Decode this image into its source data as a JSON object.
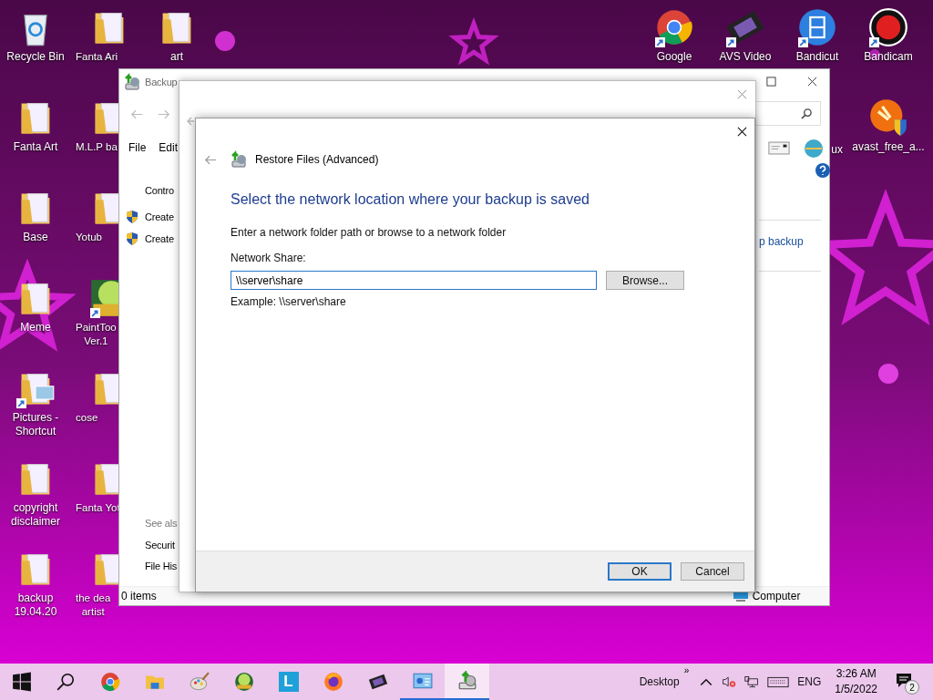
{
  "desktop": {
    "left_columns": [
      [
        {
          "label": "Recycle Bin",
          "kind": "recycle-bin",
          "shortcut": false
        },
        {
          "label": "Fanta Art",
          "kind": "folder",
          "shortcut": false
        },
        {
          "label": "Base",
          "kind": "folder",
          "shortcut": false
        },
        {
          "label": "Meme",
          "kind": "folder",
          "shortcut": false
        },
        {
          "label": "Pictures -\nShortcut",
          "kind": "pictures",
          "shortcut": true
        },
        {
          "label": "copyright\ndisclaimer",
          "kind": "folder",
          "shortcut": false
        },
        {
          "label": "backup\n19.04.20",
          "kind": "folder",
          "shortcut": false
        }
      ],
      [
        {
          "label": "Fanta Ari",
          "kind": "folder",
          "shortcut": false
        },
        {
          "label": "M.L.P ba",
          "kind": "folder",
          "shortcut": false
        },
        {
          "label": "Yotub",
          "kind": "folder",
          "shortcut": false
        },
        {
          "label": "PaintToo\nVer.1",
          "kind": "painttool",
          "shortcut": true
        },
        {
          "label": "cose",
          "kind": "folder",
          "shortcut": false
        },
        {
          "label": "Fanta Yot",
          "kind": "folder",
          "shortcut": false
        },
        {
          "label": "the dea\nartist",
          "kind": "folder",
          "shortcut": false
        }
      ],
      [
        {
          "label": "art",
          "kind": "folder",
          "shortcut": false
        }
      ]
    ],
    "right_rows": [
      [
        {
          "label": "Google",
          "kind": "chrome",
          "shortcut": true
        },
        {
          "label": "AVS Video",
          "kind": "film",
          "shortcut": true
        },
        {
          "label": "Bandicut",
          "kind": "bandicut",
          "shortcut": true
        },
        {
          "label": "Bandicam",
          "kind": "bandicam",
          "shortcut": true
        }
      ],
      [
        {
          "label": "ux",
          "kind": "covered"
        },
        {
          "label": "avast_free_a...",
          "kind": "avast",
          "shortcut": false
        }
      ]
    ]
  },
  "back_window": {
    "title": "Backup",
    "menu": [
      "File",
      "Edit"
    ],
    "left_pane": [
      {
        "kind": "heading",
        "label": "Contro"
      },
      {
        "kind": "shield-link",
        "label": "Create"
      },
      {
        "kind": "shield-link",
        "label": "Create"
      },
      {
        "kind": "see-also",
        "label": "See als"
      },
      {
        "kind": "link",
        "label": "Securit"
      },
      {
        "kind": "link",
        "label": "File His"
      }
    ],
    "right_link": "p backup",
    "status_left": "0 items",
    "status_right": "Computer"
  },
  "dialog": {
    "title": "Restore Files (Advanced)",
    "heading": "Select the network location where your backup is saved",
    "instruction": "Enter a network folder path or browse to a network folder",
    "field_label": "Network Share:",
    "field_value": "\\\\server\\share",
    "browse": "Browse...",
    "example": "Example: \\\\server\\share",
    "buttons": [
      {
        "label": "OK",
        "default": true
      },
      {
        "label": "Cancel",
        "default": false
      }
    ]
  },
  "taskbar": {
    "apps": [
      {
        "kind": "start",
        "running": false,
        "selected": false
      },
      {
        "kind": "search",
        "running": false,
        "selected": false
      },
      {
        "kind": "chrome",
        "running": false,
        "selected": false
      },
      {
        "kind": "explorer",
        "running": false,
        "selected": false
      },
      {
        "kind": "paint",
        "running": false,
        "selected": false
      },
      {
        "kind": "painttool",
        "running": false,
        "selected": false
      },
      {
        "kind": "letter",
        "label": "L",
        "running": false,
        "selected": false
      },
      {
        "kind": "firefox",
        "running": false,
        "selected": false
      },
      {
        "kind": "film",
        "running": false,
        "selected": false
      },
      {
        "kind": "control-panel",
        "running": true,
        "selected": false
      },
      {
        "kind": "backup",
        "running": true,
        "selected": true
      }
    ],
    "toolbar_label": "Desktop",
    "chevron": "»",
    "language": "ENG",
    "time": "3:26 AM",
    "date": "1/5/2022",
    "notifications": "2"
  }
}
